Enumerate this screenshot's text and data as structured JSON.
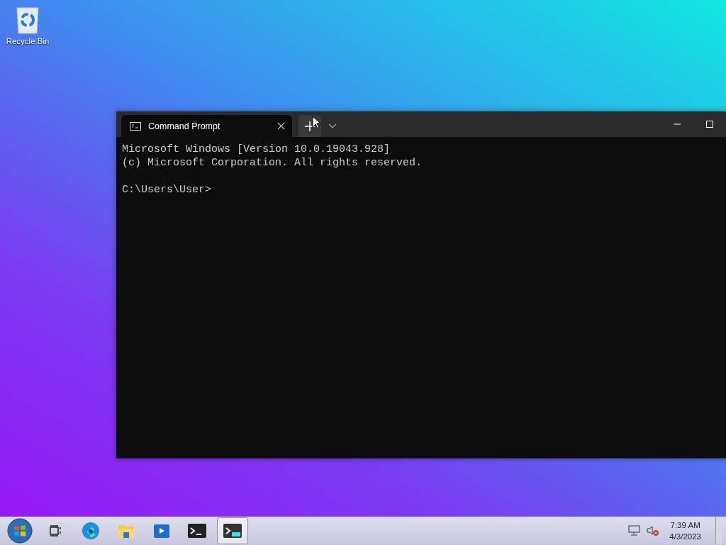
{
  "desktop_icons": [
    {
      "label": "Recycle Bin"
    }
  ],
  "terminal": {
    "tabs": [
      {
        "title": "Command Prompt",
        "selected": true
      }
    ],
    "output": [
      "Microsoft Windows [Version 10.0.19043.928]",
      "(c) Microsoft Corporation. All rights reserved."
    ],
    "prompt": "C:\\Users\\User>"
  },
  "taskbar": {
    "apps": [
      {
        "kind": "start",
        "selected": false
      },
      {
        "kind": "task-view",
        "selected": false
      },
      {
        "kind": "edge",
        "selected": false
      },
      {
        "kind": "explorer",
        "selected": false
      },
      {
        "kind": "media",
        "selected": false
      },
      {
        "kind": "console",
        "selected": false
      },
      {
        "kind": "terminal",
        "selected": true
      }
    ],
    "tray": {
      "sound_muted": true
    },
    "time": "7:39 AM",
    "date": "4/3/2023"
  }
}
